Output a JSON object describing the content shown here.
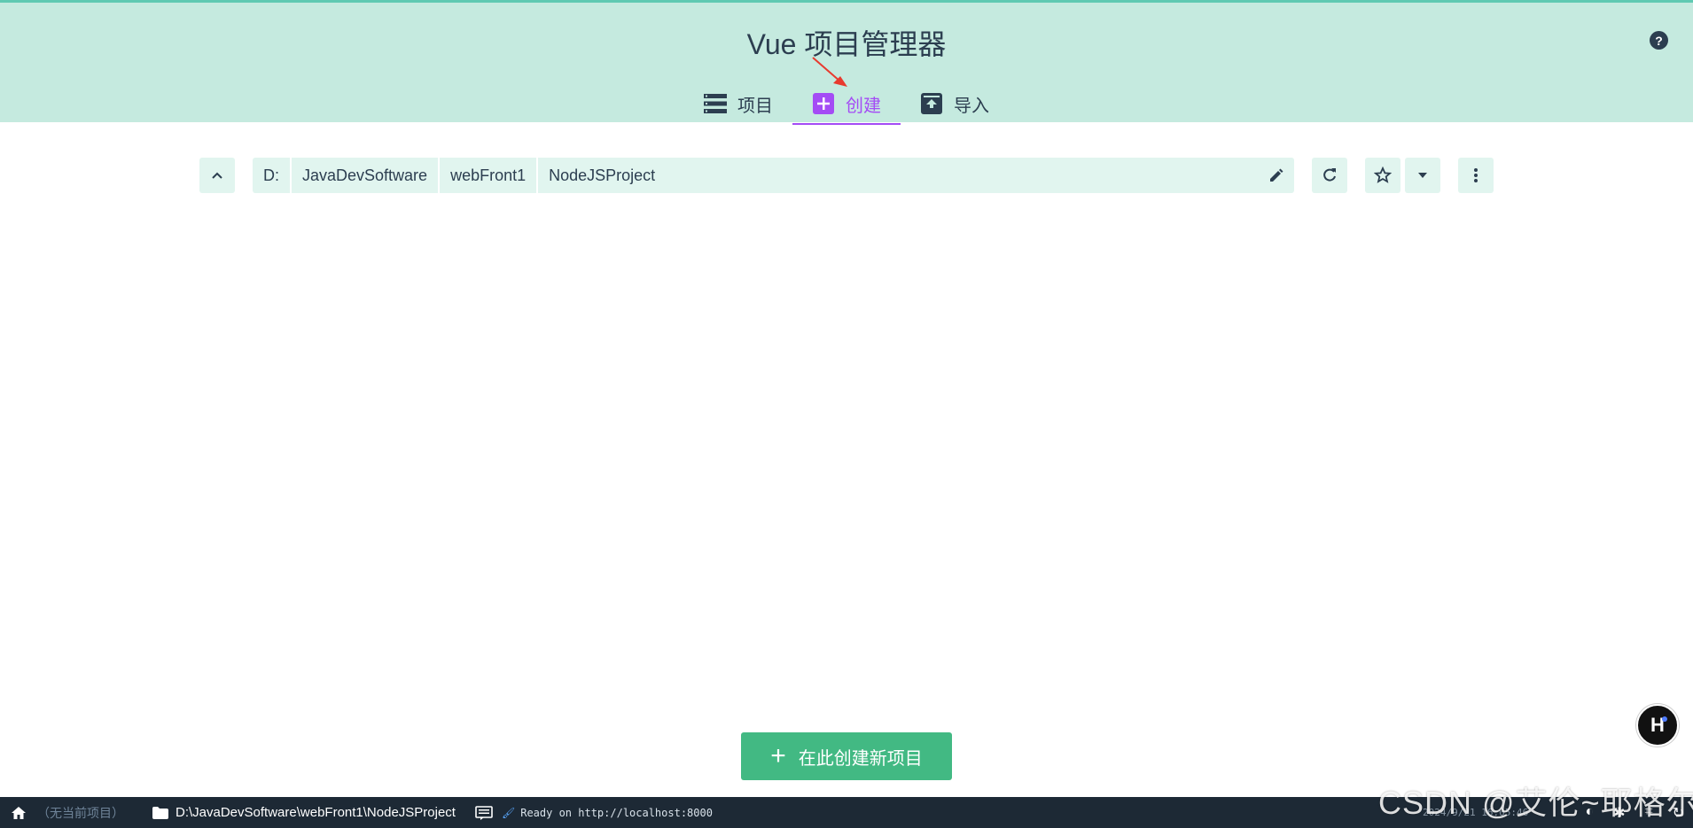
{
  "header": {
    "title": "Vue 项目管理器",
    "help_icon": "help-circle-icon"
  },
  "tabs": [
    {
      "label": "项目",
      "icon": "list-icon",
      "active": false
    },
    {
      "label": "创建",
      "icon": "add-box-icon",
      "active": true
    },
    {
      "label": "导入",
      "icon": "unarchive-icon",
      "active": false
    }
  ],
  "path": {
    "segments": [
      "D:",
      "JavaDevSoftware",
      "webFront1",
      "NodeJSProject"
    ]
  },
  "create_button": {
    "label": "在此创建新项目"
  },
  "statusbar": {
    "no_project": "（无当前项目）",
    "current_path": "D:\\JavaDevSoftware\\webFront1\\NodeJSProject",
    "log_message": "Ready on http://localhost:8000",
    "timestamp": "2024/9/21 16:05:46"
  },
  "watermark": "CSDN @艾伦~耶格尔",
  "colors": {
    "header_bg": "#c5eadf",
    "accent": "#42b983",
    "active_tab": "#a44cf5",
    "statusbar_bg": "#1d2935"
  }
}
